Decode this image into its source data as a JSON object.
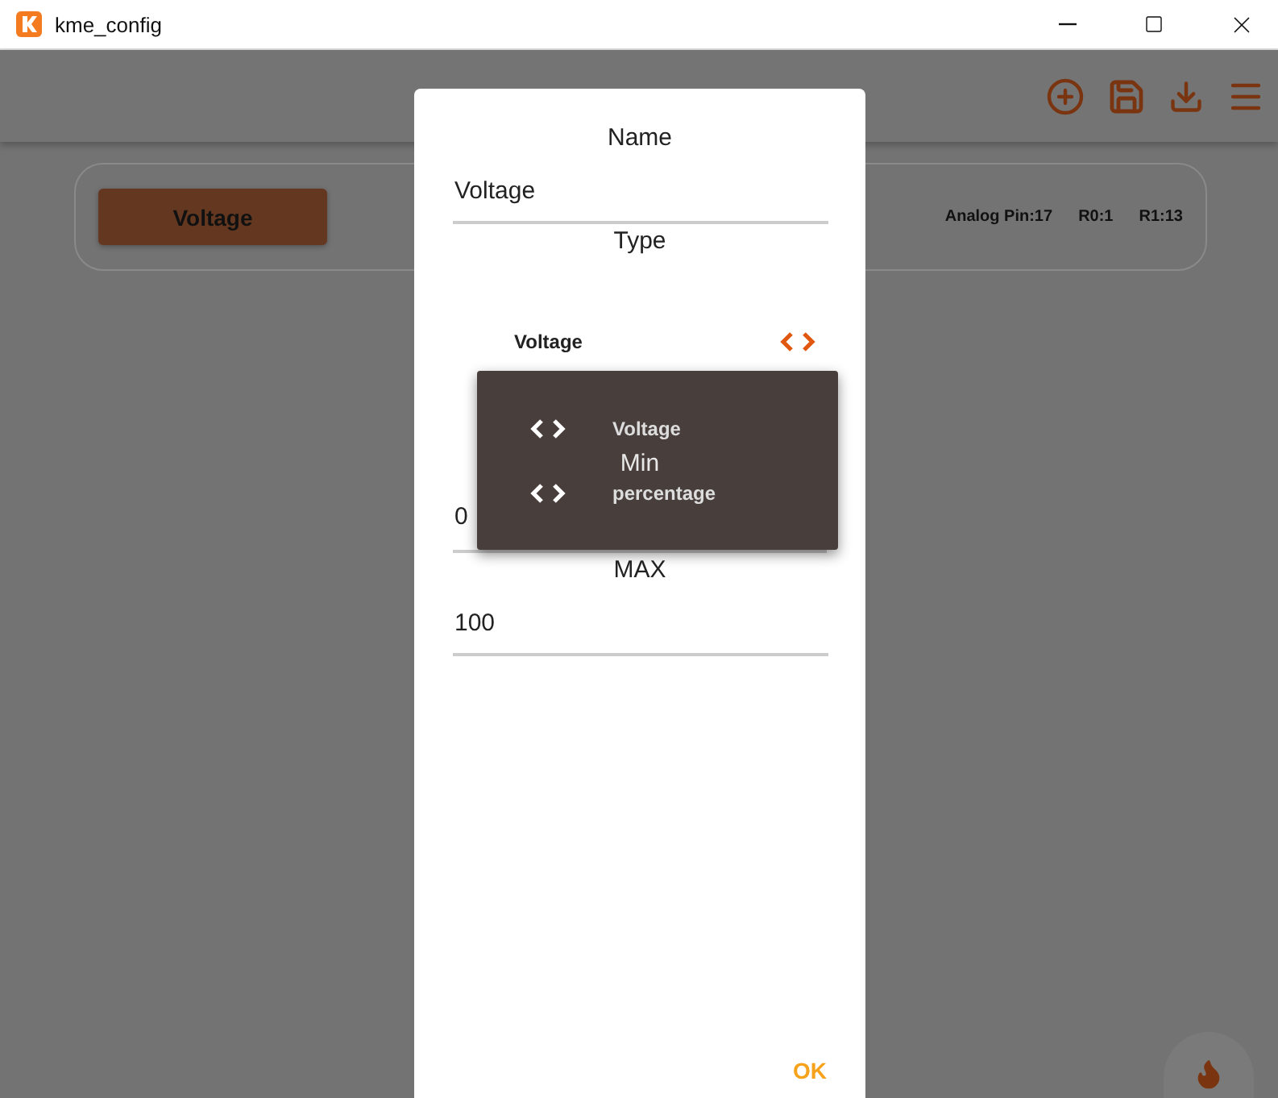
{
  "window": {
    "title": "kme_config"
  },
  "card": {
    "button": "Voltage",
    "info": [
      "Analog Pin:17",
      "R0:1",
      "R1:13"
    ]
  },
  "dialog": {
    "name": {
      "label": "Name",
      "value": "Voltage"
    },
    "type": {
      "label": "Type",
      "value": "Voltage",
      "expanded": true,
      "options": [
        "Voltage",
        "percentage"
      ]
    },
    "min": {
      "label": "Min",
      "value": "0"
    },
    "max": {
      "label": "MAX",
      "value": "100"
    },
    "ok": "OK"
  }
}
